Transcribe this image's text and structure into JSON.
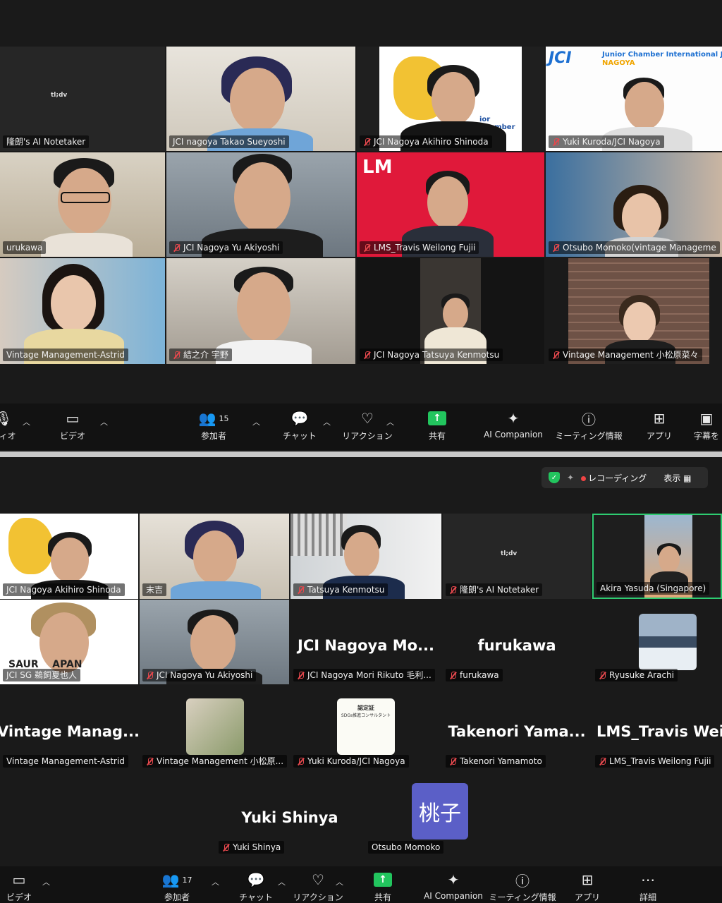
{
  "top": {
    "tiles": [
      {
        "name": "隆朗's AI Notetaker",
        "muted": false
      },
      {
        "name": "JCI nagoya  Takao Sueyoshi",
        "muted": false
      },
      {
        "name": "JCI Nagoya Akihiro Shinoda",
        "muted": true
      },
      {
        "name": "Yuki Kuroda/JCI Nagoya",
        "muted": true
      },
      {
        "name": "urukawa",
        "muted": false
      },
      {
        "name": "JCI Nagoya Yu Akiyoshi",
        "muted": true
      },
      {
        "name": "LMS_Travis Weilong Fujii",
        "muted": true
      },
      {
        "name": "Otsubo Momoko(vintage Manageme",
        "muted": true
      },
      {
        "name": "Vintage Management-Astrid",
        "muted": false
      },
      {
        "name": "結之介 宇野",
        "muted": true
      },
      {
        "name": "JCI Nagoya Tatsuya Kenmotsu",
        "muted": true
      },
      {
        "name": "Vintage Management 小松原菜々",
        "muted": true
      }
    ],
    "jci_logo": "JCI",
    "jci_banner_line1": "Junior Chamber International Japa",
    "jci_banner_line2": "NAGOYA",
    "lm_logo": "LM",
    "notetaker_brand": "tl;dv",
    "toolbar": {
      "audio": "ディオ",
      "video": "ビデオ",
      "participants": "参加者",
      "participants_count": "15",
      "chat": "チャット",
      "reactions": "リアクション",
      "share": "共有",
      "ai": "AI Companion",
      "info": "ミーティング情報",
      "apps": "アプリ",
      "captions": "字幕を"
    }
  },
  "bottom": {
    "recording_label": "レコーディング",
    "view_label": "表示",
    "tiles": [
      {
        "name": "JCI Nagoya Akihiro Shinoda",
        "muted": false
      },
      {
        "name": "末吉",
        "muted": false
      },
      {
        "name": "Tatsuya Kenmotsu",
        "muted": true
      },
      {
        "name": "隆朗's AI Notetaker",
        "muted": true
      },
      {
        "name": "Akira Yasuda (Singapore)",
        "muted": false
      },
      {
        "name": "JCI SG 鵜飼夏也人",
        "muted": false
      },
      {
        "name": "JCI Nagoya Yu Akiyoshi",
        "muted": true
      },
      {
        "name": "JCI Nagoya Mori Rikuto 毛利...",
        "muted": true,
        "big": "JCI  Nagoya  Mo..."
      },
      {
        "name": "furukawa",
        "muted": true,
        "big": "furukawa"
      },
      {
        "name": "Ryusuke Arachi",
        "muted": true
      },
      {
        "name": "Vintage Management-Astrid",
        "muted": false,
        "big": "Vintage  Manag..."
      },
      {
        "name": "Vintage Management 小松原...",
        "muted": true
      },
      {
        "name": "Yuki Kuroda/JCI Nagoya",
        "muted": true
      },
      {
        "name": "Takenori Yamamoto",
        "muted": true,
        "big": "Takenori  Yama..."
      },
      {
        "name": "LMS_Travis Weilong Fujii",
        "muted": true,
        "big": "LMS_Travis  Weil"
      },
      {
        "name": "Yuki Shinya",
        "muted": true,
        "big": "Yuki Shinya"
      },
      {
        "name": "Otsubo Momoko",
        "muted": false
      }
    ],
    "avatar_text": "桃子",
    "shirt_text": "SAUR    APAN",
    "certificate_title": "認定証",
    "certificate_sub": "SDGs推進コンサルタント",
    "toolbar": {
      "video": "ビデオ",
      "participants": "参加者",
      "participants_count": "17",
      "chat": "チャット",
      "reactions": "リアクション",
      "share": "共有",
      "ai": "AI Companion",
      "info": "ミーティング情報",
      "apps": "アプリ",
      "more": "詳細"
    }
  },
  "colors": {
    "accent_green": "#22c55e",
    "mute_red": "#e5484d",
    "lm_red": "#e0193a",
    "avatar_purple": "#5b5fc7",
    "active_speaker": "#2ecc71"
  }
}
